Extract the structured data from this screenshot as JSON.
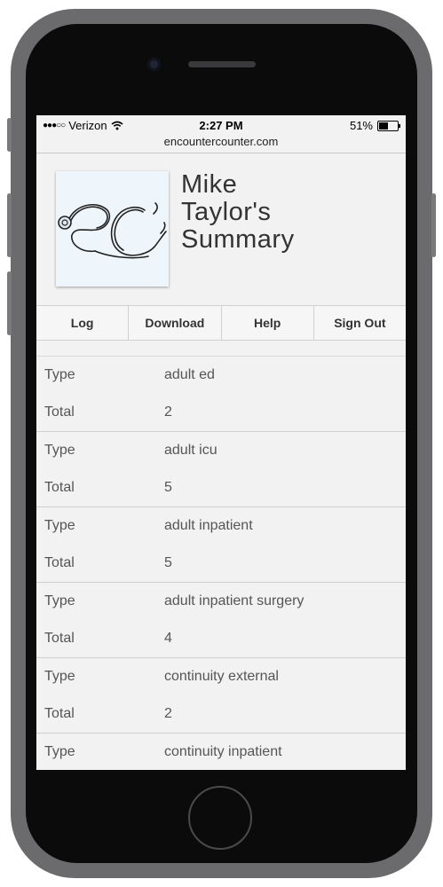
{
  "status_bar": {
    "carrier": "Verizon",
    "signal_dots": "●●●○○",
    "time": "2:27 PM",
    "battery_text": "51%",
    "battery_level": 0.51
  },
  "browser": {
    "url": "encountercounter.com"
  },
  "header": {
    "title_line1": "Mike",
    "title_line2": "Taylor's",
    "title_line3": "Summary"
  },
  "nav": {
    "log": "Log",
    "download": "Download",
    "help": "Help",
    "sign_out": "Sign Out"
  },
  "summary": [
    {
      "type_label": "Type",
      "type_value": "adult ed",
      "total_label": "Total",
      "total_value": "2"
    },
    {
      "type_label": "Type",
      "type_value": "adult icu",
      "total_label": "Total",
      "total_value": "5"
    },
    {
      "type_label": "Type",
      "type_value": "adult inpatient",
      "total_label": "Total",
      "total_value": "5"
    },
    {
      "type_label": "Type",
      "type_value": "adult inpatient surgery",
      "total_label": "Total",
      "total_value": "4"
    },
    {
      "type_label": "Type",
      "type_value": "continuity external",
      "total_label": "Total",
      "total_value": "2"
    },
    {
      "type_label": "Type",
      "type_value": "continuity inpatient"
    }
  ]
}
